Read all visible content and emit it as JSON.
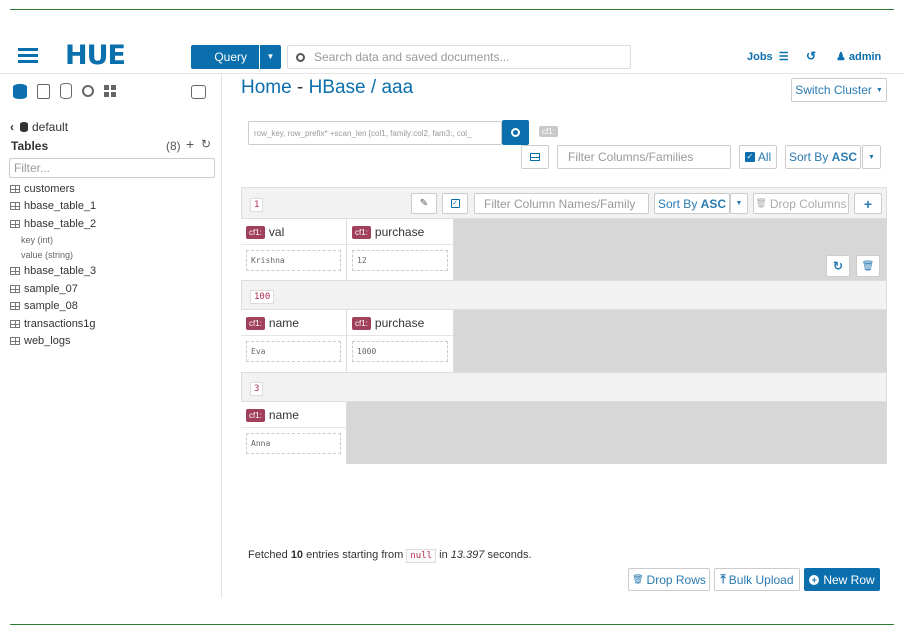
{
  "header": {
    "logo_text": "HUE",
    "query_label": "Query",
    "search_placeholder": "Search data and saved documents...",
    "jobs_label": "Jobs",
    "user_label": "admin"
  },
  "sidebar": {
    "back_label": "default",
    "tables_label": "Tables",
    "tables_count": "(8)",
    "filter_placeholder": "Filter...",
    "tables": [
      {
        "name": "customers"
      },
      {
        "name": "hbase_table_1"
      },
      {
        "name": "hbase_table_2"
      },
      {
        "name": "hbase_table_3"
      },
      {
        "name": "sample_07"
      },
      {
        "name": "sample_08"
      },
      {
        "name": "transactions1g"
      },
      {
        "name": "web_logs"
      }
    ],
    "columns": [
      "key (int)",
      "value (string)"
    ]
  },
  "main": {
    "breadcrumb_home": "Home",
    "breadcrumb_sep": " - ",
    "breadcrumb_hbase": "HBase",
    "breadcrumb_slash": " / ",
    "breadcrumb_table": "aaa",
    "switch_cluster": "Switch Cluster",
    "query_placeholder": "row_key, row_prefix* +scan_len [col1, family:col2, fam3:, col_",
    "cf_tag": "cf1:",
    "filter_columns_placeholder": "Filter Columns/Families",
    "all_label": "All",
    "sort_by_label": "Sort By",
    "sort_dir": "ASC",
    "filter_col_names_placeholder": "Filter Column Names/Family",
    "drop_columns": "Drop Columns",
    "rows": [
      {
        "key": "1",
        "cells": [
          {
            "family": "cf1:",
            "column": "val",
            "value": "Krishna"
          },
          {
            "family": "cf1:",
            "column": "purchase",
            "value": "12"
          }
        ]
      },
      {
        "key": "100",
        "cells": [
          {
            "family": "cf1:",
            "column": "name",
            "value": "Eva"
          },
          {
            "family": "cf1:",
            "column": "purchase",
            "value": "1000"
          }
        ]
      },
      {
        "key": "3",
        "cells": [
          {
            "family": "cf1:",
            "column": "name",
            "value": "Anna"
          }
        ]
      }
    ],
    "footer": {
      "fetched_prefix": "Fetched ",
      "fetched_count": "10",
      "fetched_mid": " entries starting from ",
      "fetched_start": "null",
      "fetched_in": " in ",
      "fetched_time": "13.397",
      "fetched_suffix": " seconds."
    },
    "drop_rows": "Drop Rows",
    "bulk_upload": "Bulk Upload",
    "new_row": "New Row"
  },
  "colors": {
    "primary": "#0b6fae",
    "link": "#2a7ab0",
    "badge": "#a0405a",
    "accent_line": "#2e7d32"
  }
}
